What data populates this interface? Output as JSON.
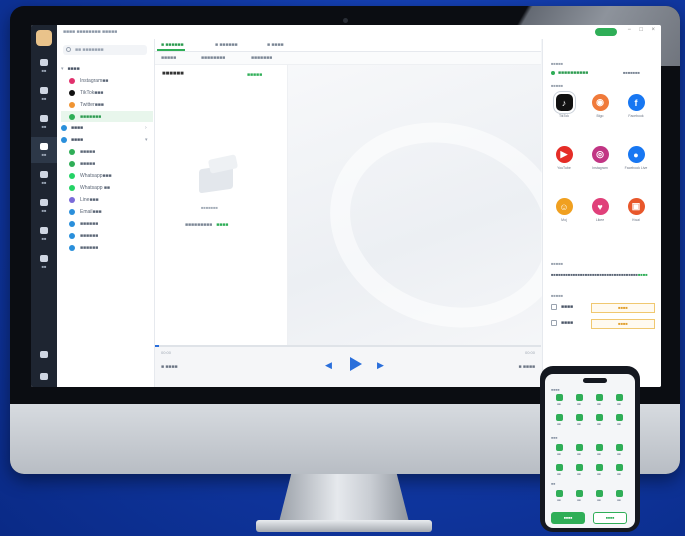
{
  "titlebar": {
    "title": "■■■■ ■■■■■■■■ ■■■■■"
  },
  "sidebar": {
    "search_placeholder": "■■ ■■■■■■■",
    "group1": "■■■■",
    "group1_items": [
      {
        "label": "Instagram■■",
        "color": "#e1306c"
      },
      {
        "label": "TikTok■■■",
        "color": "#111111"
      },
      {
        "label": "Twitter■■■",
        "color": "#f09433"
      },
      {
        "label": "■■■■■■■",
        "color": "#2fae57"
      }
    ],
    "group2": "■■■■",
    "group3": "■■■■",
    "group3_items": [
      {
        "label": "■■■■■",
        "color": "#2fae57"
      },
      {
        "label": "■■■■■",
        "color": "#2fae57"
      },
      {
        "label": "Whatsapp■■■",
        "color": "#25d366"
      },
      {
        "label": "Whatsapp ■■",
        "color": "#25d366"
      },
      {
        "label": "Line■■■",
        "color": "#7a6ad8"
      },
      {
        "label": "Email■■■",
        "color": "#2a8fdb"
      },
      {
        "label": "■■■■■■",
        "color": "#2a8fdb"
      },
      {
        "label": "■■■■■■",
        "color": "#2a8fdb"
      },
      {
        "label": "■■■■■■",
        "color": "#2a8fdb"
      }
    ]
  },
  "rail": [
    "■■",
    "■■",
    "■■",
    "■■",
    "■■",
    "■■",
    "■■",
    "■■"
  ],
  "tabs": [
    "■ ■■■■■■",
    "■ ■■■■■■",
    "■ ■■■■"
  ],
  "subtabs": [
    "■■■■■",
    "■■■■■■■■",
    "■■■■■■■"
  ],
  "content": {
    "heading": "■■■■■■",
    "heading_link": "■■■■■",
    "empty_text": "■■■■■■■",
    "empty_hint": "■■■■■■■■■",
    "empty_link": "■■■■"
  },
  "player": {
    "time_left": "00:00",
    "time_right": "00:00",
    "left_label": "■ ■■■■",
    "right_label": "■ ■■■■"
  },
  "right_panel": {
    "label1": "■■■■■",
    "account": "■■■■■■■■■■",
    "account_right": "■■■■■■■",
    "label2": "■■■■■",
    "apps": [
      {
        "name": "TikTok",
        "color": "#111111",
        "glyph": "♪"
      },
      {
        "name": "Bigo",
        "color": "#f07a3a",
        "glyph": "◉"
      },
      {
        "name": "Facebook",
        "color": "#1877f2",
        "glyph": "f"
      },
      {
        "name": "YouTube",
        "color": "#e52d27",
        "glyph": "▶"
      },
      {
        "name": "Instagram",
        "color": "#c13584",
        "glyph": "◎"
      },
      {
        "name": "Facebook Live",
        "color": "#1877f2",
        "glyph": "●"
      },
      {
        "name": "Moj",
        "color": "#f0a020",
        "glyph": "☺"
      },
      {
        "name": "Likee",
        "color": "#e0407a",
        "glyph": "♥"
      },
      {
        "name": "Kwai",
        "color": "#e8572b",
        "glyph": "▣"
      }
    ],
    "label3": "■■■■■",
    "desc_text": "■■■■■■■■■■■■■■■■■■■■■■■■■■■■■■■■■■■■",
    "desc_link": "■■■■",
    "label4": "■■■■■",
    "opt1": "■■■■",
    "opt1_value": "■■■■",
    "opt2": "■■■■",
    "opt2_value": "■■■■"
  },
  "phone": {
    "sections": [
      "■■■■",
      "■■■",
      "■■"
    ],
    "icon_labels": [
      "■■",
      "■■",
      "■■",
      "■■"
    ],
    "btn_left": "■■■■",
    "btn_right": "■■■■"
  }
}
